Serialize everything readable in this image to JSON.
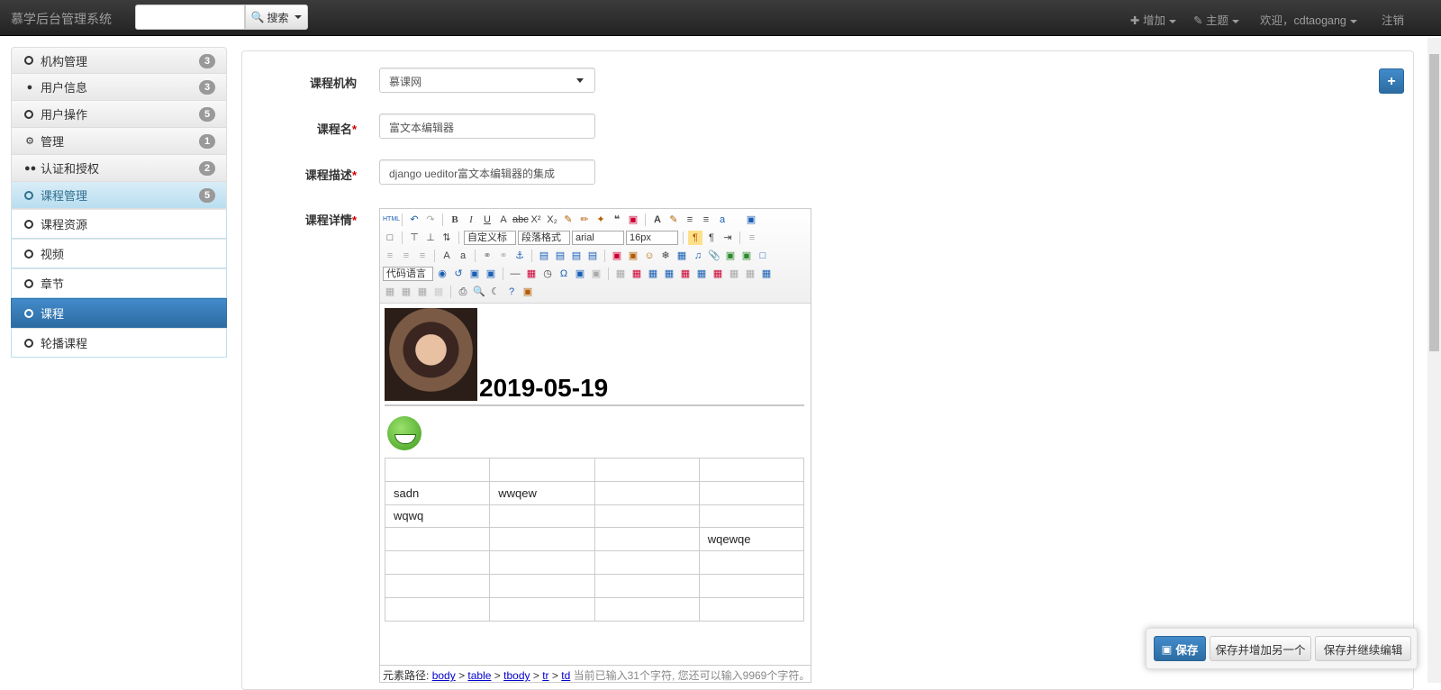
{
  "navbar": {
    "brand": "慕学后台管理系统",
    "search_value": "",
    "search_label": "搜索",
    "add_label": "增加",
    "theme_label": "主题",
    "welcome_label": "欢迎，cdtaogang",
    "logout_label": "注销"
  },
  "sidebar": {
    "groups": [
      {
        "label": "机构管理",
        "count": "3",
        "icon": "circle-icon"
      },
      {
        "label": "用户信息",
        "count": "3",
        "icon": "user-icon"
      },
      {
        "label": "用户操作",
        "count": "5",
        "icon": "circle-icon"
      },
      {
        "label": "管理",
        "count": "1",
        "icon": "gear-icon"
      },
      {
        "label": "认证和授权",
        "count": "2",
        "icon": "users-icon"
      },
      {
        "label": "课程管理",
        "count": "5",
        "icon": "circle-icon"
      }
    ],
    "subitems": [
      {
        "label": "课程资源"
      },
      {
        "label": "视频"
      },
      {
        "label": "章节"
      },
      {
        "label": "课程"
      },
      {
        "label": "轮播课程"
      }
    ]
  },
  "form": {
    "org_label": "课程机构",
    "org_value": "慕课网",
    "name_label": "课程名",
    "name_value": "富文本编辑器",
    "desc_label": "课程描述",
    "desc_value": "django ueditor富文本编辑器的集成",
    "detail_label": "课程详情",
    "required_mark": "*",
    "add_button": "+"
  },
  "editor": {
    "combos": {
      "custom_title": "自定义标",
      "paragraph": "段落格式",
      "font": "arial",
      "size": "16px",
      "code_lang": "代码语言"
    },
    "content_date": "2019-05-19",
    "table": [
      [
        "",
        "",
        "",
        ""
      ],
      [
        "sadn",
        "wwqew",
        "",
        ""
      ],
      [
        "wqwq",
        "",
        "",
        ""
      ],
      [
        "",
        "",
        "",
        "wqewqe"
      ],
      [
        "",
        "",
        "",
        ""
      ],
      [
        "",
        "",
        "",
        ""
      ],
      [
        "",
        "",
        "",
        ""
      ]
    ],
    "path_label": "元素路径:",
    "path": [
      "body",
      "table",
      "tbody",
      "tr",
      "td"
    ],
    "path_sep": ">",
    "status": "当前已输入31个字符, 您还可以输入9969个字符。"
  },
  "actions": {
    "save": "保存",
    "save_add": "保存并增加另一个",
    "save_continue": "保存并继续编辑"
  },
  "colors": {
    "primary": "#428bca",
    "navbar": "#222222",
    "active_group": "#d9edf7"
  }
}
